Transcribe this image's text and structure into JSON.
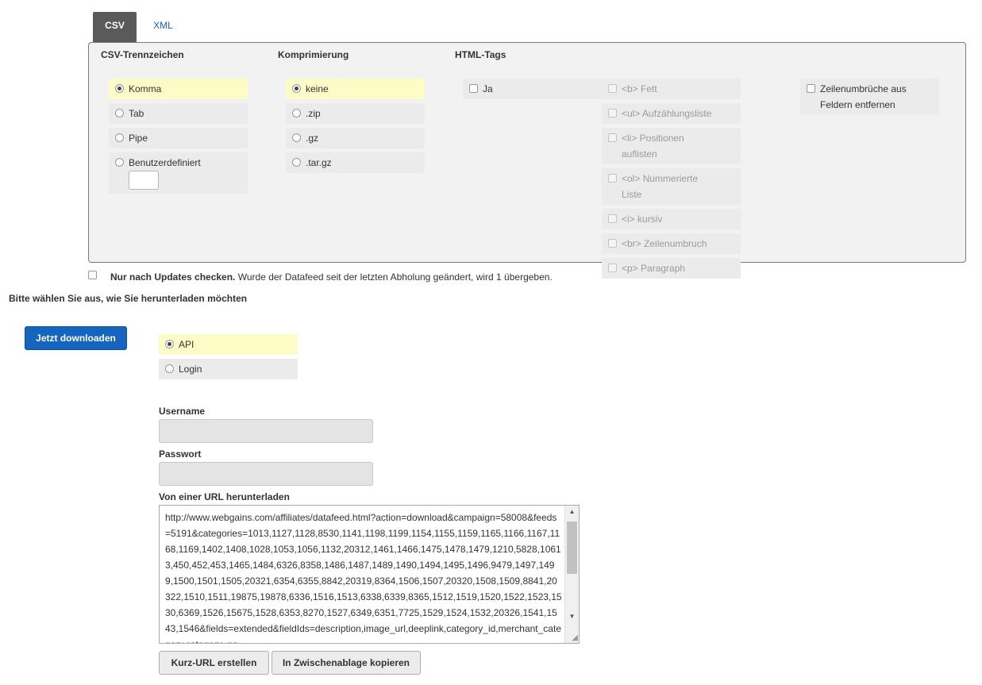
{
  "tabs": {
    "csv": "CSV",
    "xml": "XML"
  },
  "separator": {
    "heading": "CSV-Trennzeichen",
    "options": [
      "Komma",
      "Tab",
      "Pipe",
      "Benutzerdefiniert"
    ],
    "selected": "Komma",
    "custom_value": ""
  },
  "compression": {
    "heading": "Komprimierung",
    "options": [
      "keine",
      ".zip",
      ".gz",
      ".tar.gz"
    ],
    "selected": "keine"
  },
  "html_tags": {
    "heading": "HTML-Tags",
    "enable_label": "Ja",
    "tags": [
      "<b> Fett",
      "<ul> Aufzählungsliste",
      "<li> Positionen",
      "auflisten",
      "<ol> Nummerierte",
      "Liste",
      "<i> kursiv",
      "<br> Zeilenumbruch",
      "<p> Paragraph"
    ]
  },
  "linebreaks": {
    "line1": "Zeilenumbrüche aus",
    "line2": "Feldern entfernen"
  },
  "updates": {
    "bold": "Nur nach Updates checken.",
    "rest": "Wurde der Datafeed seit der letzten Abholung geändert, wird 1 übergeben."
  },
  "download": {
    "prompt": "Bitte wählen Sie aus, wie Sie herunterladen möchten",
    "button": "Jetzt downloaden",
    "methods": [
      "API",
      "Login"
    ],
    "selected": "API"
  },
  "form": {
    "username_label": "Username",
    "username_value": "",
    "password_label": "Passwort",
    "password_value": "",
    "url_label": "Von einer URL herunterladen",
    "url_value": "http://www.webgains.com/affiliates/datafeed.html?action=download&campaign=58008&feeds=5191&categories=1013,1127,1128,8530,1141,1198,1199,1154,1155,1159,1165,1166,1167,1168,1169,1402,1408,1028,1053,1056,1132,20312,1461,1466,1475,1478,1479,1210,5828,10613,450,452,453,1465,1484,6326,8358,1486,1487,1489,1490,1494,1495,1496,9479,1497,1499,1500,1501,1505,20321,6354,6355,8842,20319,8364,1506,1507,20320,1508,1509,8841,20322,1510,1511,19875,19878,6336,1516,1513,6338,6339,8365,1512,1519,1520,1522,1523,1530,6369,1526,15675,1528,6353,8270,1527,6349,6351,7725,1529,1524,1532,20326,1541,1543,1546&fields=extended&fieldIds=description,image_url,deeplink,category_id,merchant_category,category_pa"
  },
  "buttons": {
    "short_url": "Kurz-URL erstellen",
    "copy": "In Zwischenablage kopieren"
  }
}
